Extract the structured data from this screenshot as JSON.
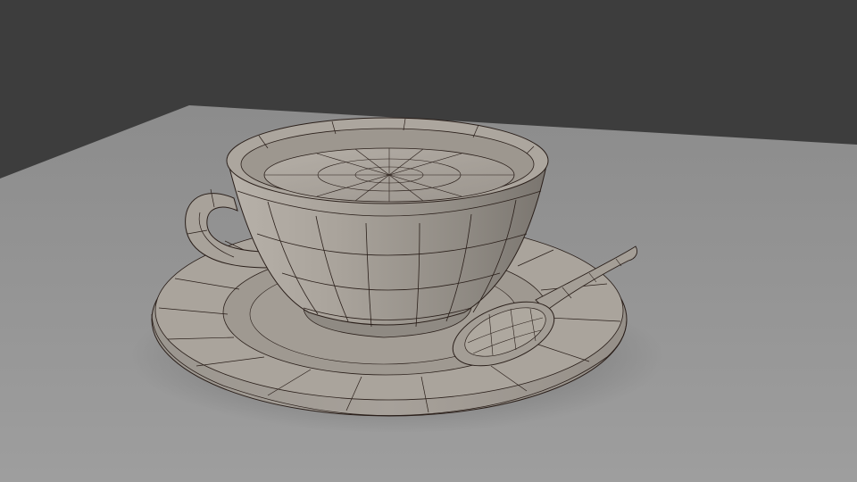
{
  "scene": {
    "objects": [
      {
        "kind": "ground-plane"
      },
      {
        "kind": "saucer"
      },
      {
        "kind": "cup"
      },
      {
        "kind": "cup-handle"
      },
      {
        "kind": "spoon"
      }
    ],
    "shading": "wireframe-on-shaded",
    "colors": {
      "background": "#3d3d3d",
      "ground": "#9a9a9a",
      "ground_far": "#8e8e8e",
      "ceramic": "#a59f97",
      "ceramic_light": "#b8b2aa",
      "ceramic_dark": "#6f6963",
      "wire": "#2a1f1a"
    }
  }
}
